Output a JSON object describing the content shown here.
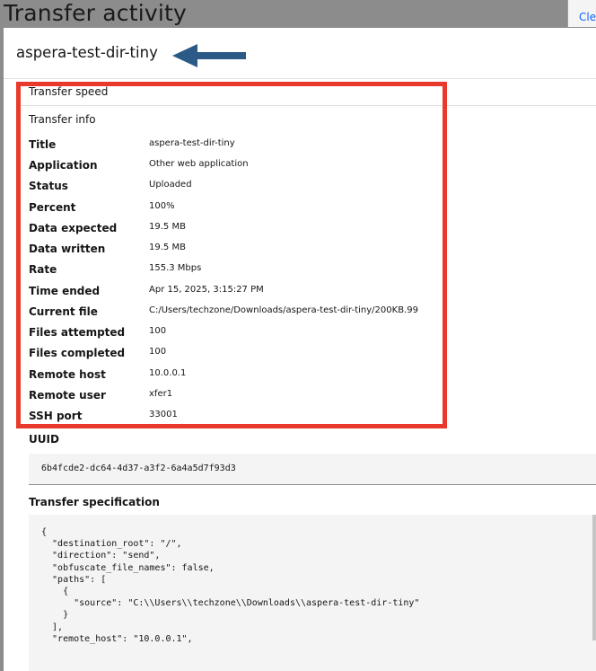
{
  "background": {
    "page_title": "Transfer activity",
    "clear_label": "Cle"
  },
  "panel": {
    "title": "aspera-test-dir-tiny",
    "arrow_color": "#2a5a85",
    "highlight_color": "#e8392a",
    "section_speed": "Transfer speed",
    "section_info": "Transfer info",
    "info": [
      {
        "key": "Title",
        "value": "aspera-test-dir-tiny"
      },
      {
        "key": "Application",
        "value": "Other web application"
      },
      {
        "key": "Status",
        "value": "Uploaded"
      },
      {
        "key": "Percent",
        "value": "100%"
      },
      {
        "key": "Data expected",
        "value": "19.5 MB"
      },
      {
        "key": "Data written",
        "value": "19.5 MB"
      },
      {
        "key": "Rate",
        "value": "155.3 Mbps"
      },
      {
        "key": "Time ended",
        "value": "Apr 15, 2025, 3:15:27 PM"
      },
      {
        "key": "Current file",
        "value": "C:/Users/techzone/Downloads/aspera-test-dir-tiny/200KB.99"
      },
      {
        "key": "Files attempted",
        "value": "100"
      },
      {
        "key": "Files completed",
        "value": "100"
      },
      {
        "key": "Remote host",
        "value": "10.0.0.1"
      },
      {
        "key": "Remote user",
        "value": "xfer1"
      },
      {
        "key": "SSH port",
        "value": "33001"
      }
    ],
    "uuid_label": "UUID",
    "uuid_value": "6b4fcde2-dc64-4d37-a3f2-6a4a5d7f93d3",
    "spec_label": "Transfer specification",
    "spec_lines": [
      "{",
      "  \"destination_root\": \"/\",",
      "  \"direction\": \"send\",",
      "  \"obfuscate_file_names\": false,",
      "  \"paths\": [",
      "    {",
      "      \"source\": \"C:\\\\Users\\\\techzone\\\\Downloads\\\\aspera-test-dir-tiny\"",
      "    }",
      "  ],",
      "  \"remote_host\": \"10.0.0.1\","
    ]
  }
}
